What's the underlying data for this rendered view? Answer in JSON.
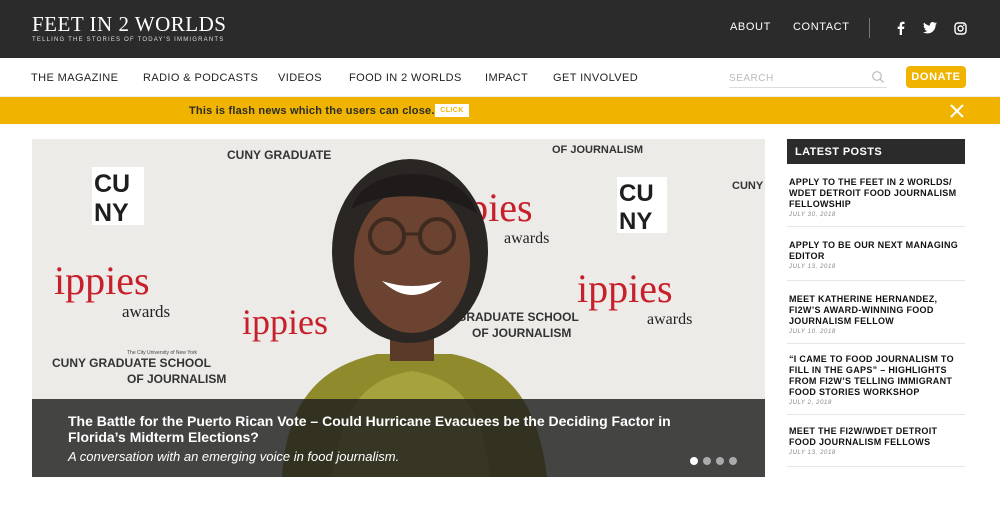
{
  "header": {
    "logo_title": "FEET IN 2 WORLDS",
    "logo_tagline": "TELLING THE STORIES OF TODAY'S IMMIGRANTS",
    "top_links": [
      "ABOUT",
      "CONTACT"
    ],
    "social_icons": [
      "facebook-icon",
      "twitter-icon",
      "instagram-icon"
    ],
    "background": "#2b2b2b"
  },
  "nav": {
    "items": [
      "THE MAGAZINE",
      "RADIO & PODCASTS",
      "VIDEOS",
      "FOOD IN 2 WORLDS",
      "IMPACT",
      "GET INVOLVED"
    ],
    "search_placeholder": "SEARCH",
    "donate_label": "DONATE"
  },
  "flash": {
    "text": "This is flash news which the users can close.",
    "button_label": "CLICK",
    "color": "#f0b400"
  },
  "hero": {
    "title": "The Battle for the Puerto Rican Vote – Could Hurricane Evacuees be the Deciding Factor in Florida’s Midterm Elections?",
    "subtitle": "A conversation with an emerging voice in food journalism.",
    "backdrop_words": {
      "cuny_top": "CU",
      "cuny_bottom": "NY",
      "ippies": "ippies",
      "awards": "awards",
      "cuny_graduate": "CUNY GRADUATE",
      "cuny_graduate_school": "CUNY GRADUATE SCHOOL",
      "of_journalism": "OF JOURNALISM",
      "the_city_university": "The City University of New York",
      "graduate_school": "GRADUATE SCHOOL"
    },
    "slide_count": 4,
    "active_slide": 1
  },
  "sidebar": {
    "heading": "LATEST POSTS",
    "posts": [
      {
        "title": "APPLY TO THE FEET IN 2 WORLDS/ WDET DETROIT FOOD JOURNALISM FELLOWSHIP",
        "date": "JULY 30, 2018"
      },
      {
        "title": "APPLY TO BE OUR NEXT MANAGING EDITOR",
        "date": "JULY 13, 2018"
      },
      {
        "title": "MEET KATHERINE HERNANDEZ, FI2W’S AWARD-WINNING FOOD JOURNALISM FELLOW",
        "date": "JULY 10, 2018"
      },
      {
        "title": "“I CAME TO FOOD JOURNALISM TO FILL IN THE GAPS” – HIGHLIGHTS FROM FI2W’S TELLING IMMIGRANT FOOD STORIES WORKSHOP",
        "date": "JULY 2, 2018"
      },
      {
        "title": "MEET THE FI2W/WDET DETROIT FOOD JOURNALISM FELLOWS",
        "date": "JULY 13, 2018"
      }
    ]
  }
}
